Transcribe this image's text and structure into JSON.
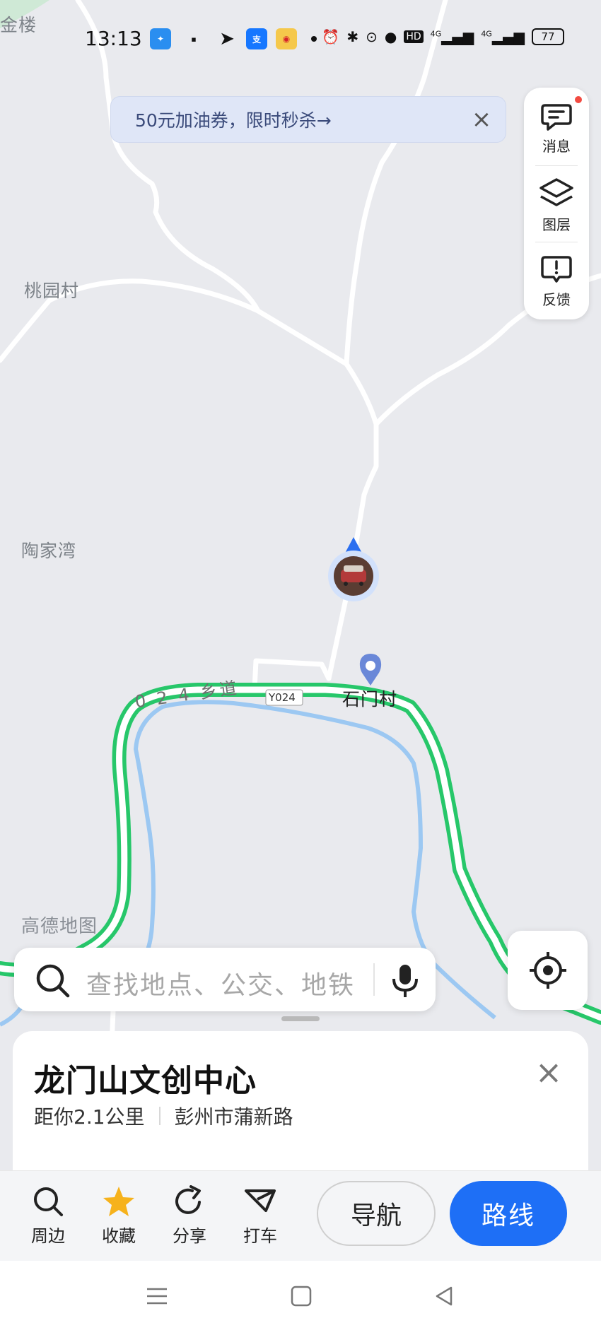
{
  "status_bar": {
    "time": "13:13",
    "battery": "77",
    "network_labels": [
      "HD",
      "4G",
      "4G"
    ]
  },
  "promo": {
    "text": "50元加油券，限时秒杀→"
  },
  "map_tools": [
    {
      "label": "消息",
      "icon": "message-icon"
    },
    {
      "label": "图层",
      "icon": "layers-icon"
    },
    {
      "label": "反馈",
      "icon": "feedback-icon"
    }
  ],
  "map_labels": {
    "corner": "金楼",
    "taoyuan": "桃园村",
    "taojiawan": "陶家湾",
    "shimen": "石门村",
    "road_name": "0 2 4 乡道",
    "road_shield": "Y024",
    "watermark": "高德地图"
  },
  "search": {
    "placeholder": "查找地点、公交、地铁"
  },
  "place": {
    "name": "龙门山文创中心",
    "distance": "距你2.1公里",
    "address": "彭州市蒲新路"
  },
  "actions": [
    {
      "label": "周边",
      "icon": "search-icon"
    },
    {
      "label": "收藏",
      "icon": "star-icon"
    },
    {
      "label": "分享",
      "icon": "share-icon"
    },
    {
      "label": "打车",
      "icon": "taxi-icon"
    }
  ],
  "buttons": {
    "navigate": "导航",
    "route": "路线"
  },
  "colors": {
    "route_green": "#27c76a",
    "accent_blue": "#1e6ff6",
    "water_blue": "#9cc8f2"
  }
}
